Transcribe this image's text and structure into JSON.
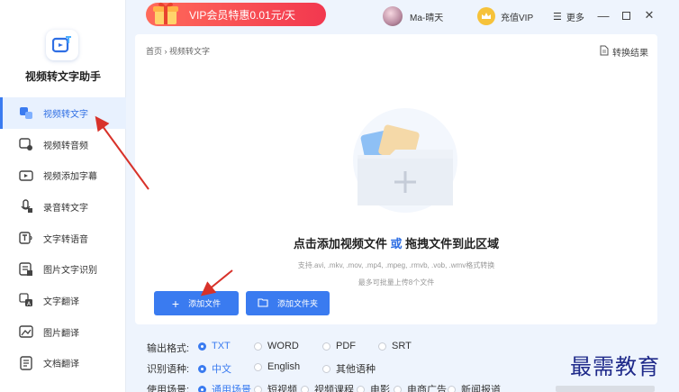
{
  "app": {
    "name": "视频转文字助手"
  },
  "topbar": {
    "promo_text": "VIP会员特惠0.01元/天",
    "user_name": "Ma-晴天",
    "vip_label": "充值VIP",
    "more_label": "更多"
  },
  "sidebar": {
    "items": [
      {
        "label": "视频转文字",
        "icon": "video-text-icon",
        "active": true
      },
      {
        "label": "视频转音频",
        "icon": "video-audio-icon"
      },
      {
        "label": "视频添加字幕",
        "icon": "subtitle-icon"
      },
      {
        "label": "录音转文字",
        "icon": "microphone-icon"
      },
      {
        "label": "文字转语音",
        "icon": "text-speech-icon"
      },
      {
        "label": "图片文字识别",
        "icon": "image-ocr-icon"
      },
      {
        "label": "文字翻译",
        "icon": "translate-icon"
      },
      {
        "label": "图片翻译",
        "icon": "image-translate-icon"
      },
      {
        "label": "文档翻译",
        "icon": "doc-translate-icon"
      }
    ]
  },
  "main": {
    "breadcrumb": "首页 › 视频转文字",
    "result_link": "转换结果",
    "drop_text_a": "点击添加视频文件",
    "drop_text_or": "或",
    "drop_text_b": "拖拽文件到此区域",
    "formats": "支持.avi, .mkv, .mov, .mp4, .mpeg, .rmvb, .vob, .wmv格式转换",
    "limit": "最多可批量上传8个文件",
    "add_file": "添加文件",
    "add_folder": "添加文件夹"
  },
  "options": {
    "format_label": "输出格式:",
    "formats": [
      "TXT",
      "WORD",
      "PDF",
      "SRT"
    ],
    "lang_label": "识别语种:",
    "langs": [
      "中文",
      "English",
      "其他语种"
    ],
    "scene_label": "使用场景:",
    "scenes": [
      "通用场景",
      "短视频",
      "视频课程",
      "电影",
      "电商广告",
      "新闻报道"
    ]
  },
  "watermark": "最需教育",
  "colors": {
    "accent": "#3a7bf0",
    "promo": "#f2384f"
  }
}
